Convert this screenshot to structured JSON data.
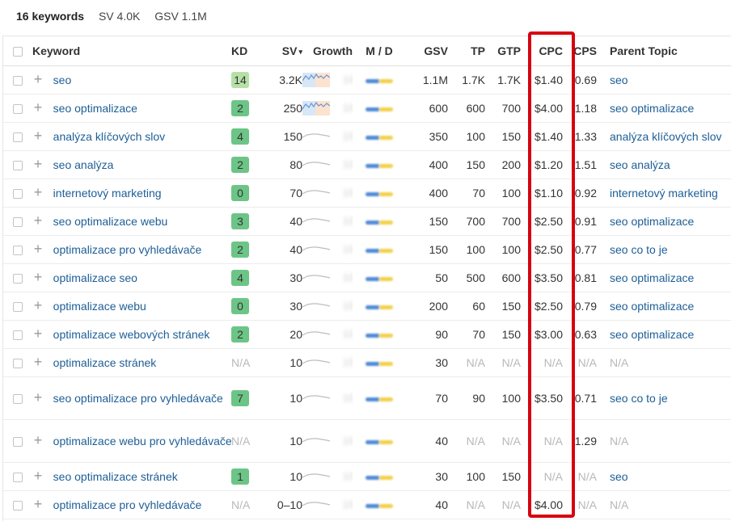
{
  "summary": {
    "keywords": "16 keywords",
    "sv": "SV 4.0K",
    "gsv": "GSV 1.1M"
  },
  "headers": {
    "keyword": "Keyword",
    "kd": "KD",
    "sv": "SV",
    "growth": "Growth",
    "md": "M / D",
    "gsv": "GSV",
    "tp": "TP",
    "gtp": "GTP",
    "cpc": "CPC",
    "cps": "CPS",
    "parent": "Parent Topic"
  },
  "sort_arrow_icon": "▾",
  "growth_blurred": "100%",
  "rows": [
    {
      "keyword": "seo",
      "kd": "14",
      "kd_level": "green",
      "sv": "3.2K",
      "spark": "rich",
      "gsv": "1.1M",
      "tp": "1.7K",
      "gtp": "1.7K",
      "cpc": "$1.40",
      "cps": "0.69",
      "parent": "seo"
    },
    {
      "keyword": "seo optimalizace",
      "kd": "2",
      "kd_level": "green",
      "sv": "250",
      "spark": "rich",
      "gsv": "600",
      "tp": "600",
      "gtp": "700",
      "cpc": "$4.00",
      "cps": "1.18",
      "parent": "seo optimalizace"
    },
    {
      "keyword": "analýza klíčových slov",
      "kd": "4",
      "kd_level": "green",
      "sv": "150",
      "spark": "flat",
      "gsv": "350",
      "tp": "100",
      "gtp": "150",
      "cpc": "$1.40",
      "cps": "1.33",
      "parent": "analýza klíčových slov"
    },
    {
      "keyword": "seo analýza",
      "kd": "2",
      "kd_level": "green",
      "sv": "80",
      "spark": "flat",
      "gsv": "400",
      "tp": "150",
      "gtp": "200",
      "cpc": "$1.20",
      "cps": "1.51",
      "parent": "seo analýza"
    },
    {
      "keyword": "internetový marketing",
      "kd": "0",
      "kd_level": "green",
      "sv": "70",
      "spark": "flat",
      "gsv": "400",
      "tp": "70",
      "gtp": "100",
      "cpc": "$1.10",
      "cps": "0.92",
      "parent": "internetový marketing"
    },
    {
      "keyword": "seo optimalizace webu",
      "kd": "3",
      "kd_level": "green",
      "sv": "40",
      "spark": "flat",
      "gsv": "150",
      "tp": "700",
      "gtp": "700",
      "cpc": "$2.50",
      "cps": "0.91",
      "parent": "seo optimalizace"
    },
    {
      "keyword": "optimalizace pro vyhledávače",
      "kd": "2",
      "kd_level": "green",
      "sv": "40",
      "spark": "flat",
      "gsv": "150",
      "tp": "100",
      "gtp": "100",
      "cpc": "$2.50",
      "cps": "0.77",
      "parent": "seo co to je"
    },
    {
      "keyword": "optimalizace seo",
      "kd": "4",
      "kd_level": "green",
      "sv": "30",
      "spark": "flat",
      "gsv": "50",
      "tp": "500",
      "gtp": "600",
      "cpc": "$3.50",
      "cps": "0.81",
      "parent": "seo optimalizace"
    },
    {
      "keyword": "optimalizace webu",
      "kd": "0",
      "kd_level": "green",
      "sv": "30",
      "spark": "flat",
      "gsv": "200",
      "tp": "60",
      "gtp": "150",
      "cpc": "$2.50",
      "cps": "0.79",
      "parent": "seo optimalizace"
    },
    {
      "keyword": "optimalizace webových stránek",
      "kd": "2",
      "kd_level": "green",
      "sv": "20",
      "spark": "flat",
      "gsv": "90",
      "tp": "70",
      "gtp": "150",
      "cpc": "$3.00",
      "cps": "0.63",
      "parent": "seo optimalizace"
    },
    {
      "keyword": "optimalizace stránek",
      "kd": "N/A",
      "kd_level": "na",
      "sv": "10",
      "spark": "flat",
      "gsv": "30",
      "tp": "N/A",
      "gtp": "N/A",
      "cpc": "N/A",
      "cps": "N/A",
      "parent": "N/A"
    },
    {
      "keyword": "seo optimalizace pro vyhledávače",
      "kd": "7",
      "kd_level": "green",
      "sv": "10",
      "spark": "flat",
      "gsv": "70",
      "tp": "90",
      "gtp": "100",
      "cpc": "$3.50",
      "cps": "0.71",
      "parent": "seo co to je",
      "tall": true
    },
    {
      "keyword": "optimalizace webu pro vyhledávače",
      "kd": "N/A",
      "kd_level": "na",
      "sv": "10",
      "spark": "flat",
      "gsv": "40",
      "tp": "N/A",
      "gtp": "N/A",
      "cpc": "N/A",
      "cps": "1.29",
      "parent": "N/A",
      "tall": true
    },
    {
      "keyword": "seo optimalizace stránek",
      "kd": "1",
      "kd_level": "green",
      "sv": "10",
      "spark": "flat",
      "gsv": "30",
      "tp": "100",
      "gtp": "150",
      "cpc": "N/A",
      "cps": "N/A",
      "parent": "seo"
    },
    {
      "keyword": "optimalizace pro vyhledávače",
      "kd": "N/A",
      "kd_level": "na",
      "sv": "0–10",
      "spark": "flat",
      "gsv": "40",
      "tp": "N/A",
      "gtp": "N/A",
      "cpc": "$4.00",
      "cps": "N/A",
      "parent": "N/A"
    }
  ],
  "colors": {
    "link": "#1d5e96",
    "highlight": "#d7000f",
    "kd_green": "#6cc587",
    "kd_lime": "#b6e0a6"
  }
}
